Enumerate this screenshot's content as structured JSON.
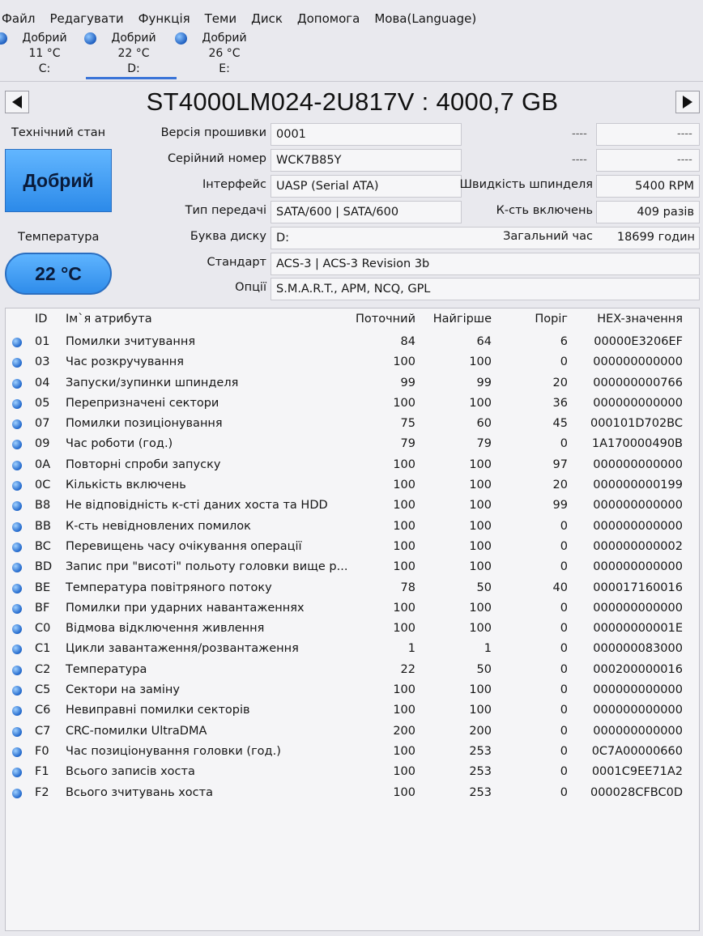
{
  "menu": [
    "Файл",
    "Редагувати",
    "Функція",
    "Теми",
    "Диск",
    "Допомога",
    "Мова(Language)"
  ],
  "disks": [
    {
      "status": "Добрий",
      "temp": "11 °C",
      "letter": "C:"
    },
    {
      "status": "Добрий",
      "temp": "22 °C",
      "letter": "D:"
    },
    {
      "status": "Добрий",
      "temp": "26 °C",
      "letter": "E:"
    }
  ],
  "title": "ST4000LM024-2U817V : 4000,7 GB",
  "health": {
    "label": "Технічний стан",
    "value": "Добрий"
  },
  "temperature": {
    "label": "Температура",
    "value": "22 °C"
  },
  "info": {
    "firmware_label": "Версія прошивки",
    "firmware": "0001",
    "serial_label": "Серійний номер",
    "serial": "WCK7B85Y",
    "interface_label": "Інтерфейс",
    "interface": "UASP (Serial ATA)",
    "transfer_label": "Тип передачі",
    "transfer": "SATA/600 | SATA/600",
    "letter_label": "Буква диску",
    "letter": "D:",
    "standard_label": "Стандарт",
    "standard": "ACS-3 | ACS-3 Revision 3b",
    "options_label": "Опції",
    "options": "S.M.A.R.T., APM, NCQ, GPL",
    "dash": "----",
    "rpm_label": "Швидкість шпинделя",
    "rpm": "5400 RPM",
    "power_count_label": "К-сть включень",
    "power_count": "409 разів",
    "hours_label": "Загальний час",
    "hours": "18699 годин"
  },
  "table": {
    "headers": {
      "id": "ID",
      "name": "Ім`я атрибута",
      "current": "Поточний",
      "worst": "Найгірше",
      "threshold": "Поріг",
      "hex": "HEX-значення"
    },
    "rows": [
      {
        "id": "01",
        "name": "Помилки зчитування",
        "current": "84",
        "worst": "64",
        "threshold": "6",
        "hex": "00000E3206EF"
      },
      {
        "id": "03",
        "name": "Час розкручування",
        "current": "100",
        "worst": "100",
        "threshold": "0",
        "hex": "000000000000"
      },
      {
        "id": "04",
        "name": "Запуски/зупинки шпинделя",
        "current": "99",
        "worst": "99",
        "threshold": "20",
        "hex": "000000000766"
      },
      {
        "id": "05",
        "name": "Перепризначені сектори",
        "current": "100",
        "worst": "100",
        "threshold": "36",
        "hex": "000000000000"
      },
      {
        "id": "07",
        "name": "Помилки позиціонування",
        "current": "75",
        "worst": "60",
        "threshold": "45",
        "hex": "000101D702BC"
      },
      {
        "id": "09",
        "name": "Час роботи (год.)",
        "current": "79",
        "worst": "79",
        "threshold": "0",
        "hex": "1A170000490B"
      },
      {
        "id": "0A",
        "name": "Повторні спроби запуску",
        "current": "100",
        "worst": "100",
        "threshold": "97",
        "hex": "000000000000"
      },
      {
        "id": "0C",
        "name": "Кількість включень",
        "current": "100",
        "worst": "100",
        "threshold": "20",
        "hex": "000000000199"
      },
      {
        "id": "B8",
        "name": "Не відповідність к-сті даних хоста та HDD",
        "current": "100",
        "worst": "100",
        "threshold": "99",
        "hex": "000000000000"
      },
      {
        "id": "BB",
        "name": "К-сть невідновлених помилок",
        "current": "100",
        "worst": "100",
        "threshold": "0",
        "hex": "000000000000"
      },
      {
        "id": "BC",
        "name": "Перевищень часу очікування операції",
        "current": "100",
        "worst": "100",
        "threshold": "0",
        "hex": "000000000002"
      },
      {
        "id": "BD",
        "name": "Запис при \"висоті\" польоту головки вище р...",
        "current": "100",
        "worst": "100",
        "threshold": "0",
        "hex": "000000000000"
      },
      {
        "id": "BE",
        "name": "Температура повітряного потоку",
        "current": "78",
        "worst": "50",
        "threshold": "40",
        "hex": "000017160016"
      },
      {
        "id": "BF",
        "name": "Помилки при ударних навантаженнях",
        "current": "100",
        "worst": "100",
        "threshold": "0",
        "hex": "000000000000"
      },
      {
        "id": "C0",
        "name": "Відмова відключення живлення",
        "current": "100",
        "worst": "100",
        "threshold": "0",
        "hex": "00000000001E"
      },
      {
        "id": "C1",
        "name": "Цикли завантаження/розвантаження",
        "current": "1",
        "worst": "1",
        "threshold": "0",
        "hex": "000000083000"
      },
      {
        "id": "C2",
        "name": "Температура",
        "current": "22",
        "worst": "50",
        "threshold": "0",
        "hex": "000200000016"
      },
      {
        "id": "C5",
        "name": "Сектори на заміну",
        "current": "100",
        "worst": "100",
        "threshold": "0",
        "hex": "000000000000"
      },
      {
        "id": "C6",
        "name": "Невиправні помилки секторів",
        "current": "100",
        "worst": "100",
        "threshold": "0",
        "hex": "000000000000"
      },
      {
        "id": "C7",
        "name": "CRC-помилки UltraDMA",
        "current": "200",
        "worst": "200",
        "threshold": "0",
        "hex": "000000000000"
      },
      {
        "id": "F0",
        "name": "Час позиціонування головки (год.)",
        "current": "100",
        "worst": "253",
        "threshold": "0",
        "hex": "0C7A00000660"
      },
      {
        "id": "F1",
        "name": "Всього записів хоста",
        "current": "100",
        "worst": "253",
        "threshold": "0",
        "hex": "0001C9EE71A2"
      },
      {
        "id": "F2",
        "name": "Всього зчитувань хоста",
        "current": "100",
        "worst": "253",
        "threshold": "0",
        "hex": "000028CFBC0D"
      }
    ]
  }
}
